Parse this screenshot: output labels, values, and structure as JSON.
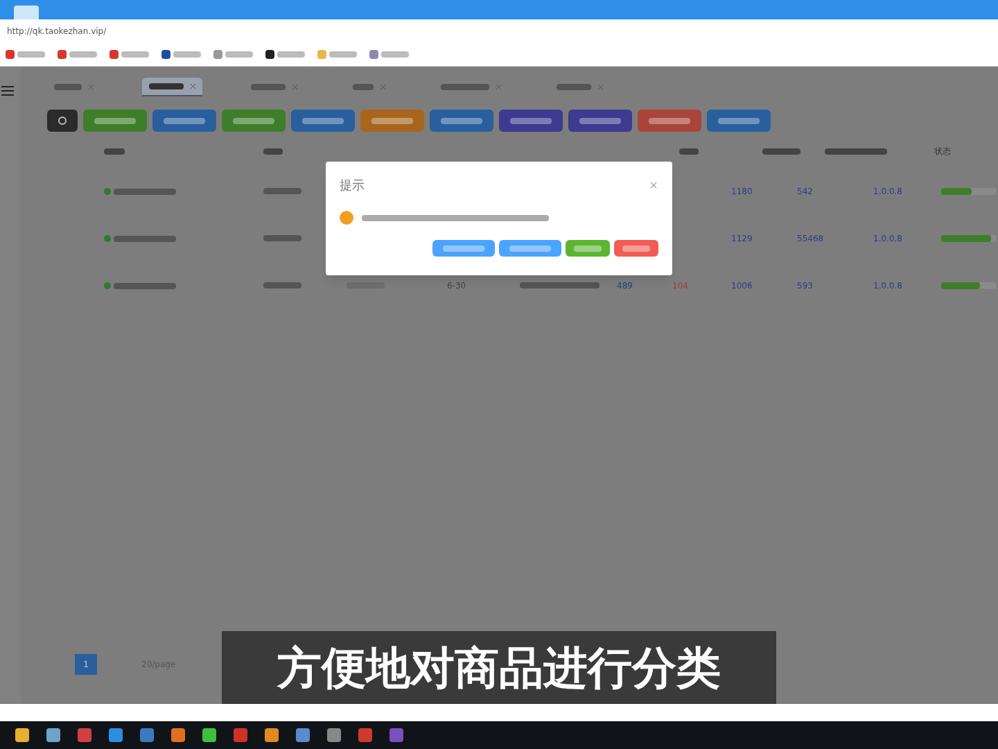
{
  "browser": {
    "url": "http://qk.taokezhan.vip/"
  },
  "toolbar_buttons": [
    {
      "color": "#2b2b2b"
    },
    {
      "color": "#3e7d2a"
    },
    {
      "color": "#2a5f9e"
    },
    {
      "color": "#3e7d2a"
    },
    {
      "color": "#2a5f9e"
    },
    {
      "color": "#a8661c"
    },
    {
      "color": "#2a5f9e"
    },
    {
      "color": "#3d3a8f"
    },
    {
      "color": "#3d3a8f"
    },
    {
      "color": "#a8443a"
    },
    {
      "color": "#2a5f9e"
    }
  ],
  "table": {
    "status_header": "状态",
    "rows": [
      {
        "cells": [
          "1180",
          "542",
          "1.0.0.8"
        ],
        "level": 0.55
      },
      {
        "cells": [
          "1129",
          "55468",
          "1.0.0.8"
        ],
        "level": 0.9
      },
      {
        "col_4": "6-30",
        "col_6": "489",
        "col_7": "104",
        "cells": [
          "1006",
          "593",
          "1.0.0.8"
        ],
        "level": 0.7
      }
    ]
  },
  "dialog": {
    "title": "提示",
    "close": "×",
    "buttons": [
      {
        "color": "#4aa3ff"
      },
      {
        "color": "#4aa3ff"
      },
      {
        "color": "#5cb531"
      },
      {
        "color": "#f25c54"
      }
    ]
  },
  "nav_tabs": [
    {
      "selected": false
    },
    {
      "selected": true
    },
    {
      "selected": false
    },
    {
      "selected": false
    },
    {
      "selected": false
    },
    {
      "selected": false
    }
  ],
  "pagination": {
    "pages": [
      {
        "label": "1",
        "selected": true
      }
    ],
    "page_size": "20/page"
  },
  "caption": "方便地对商品进行分类"
}
